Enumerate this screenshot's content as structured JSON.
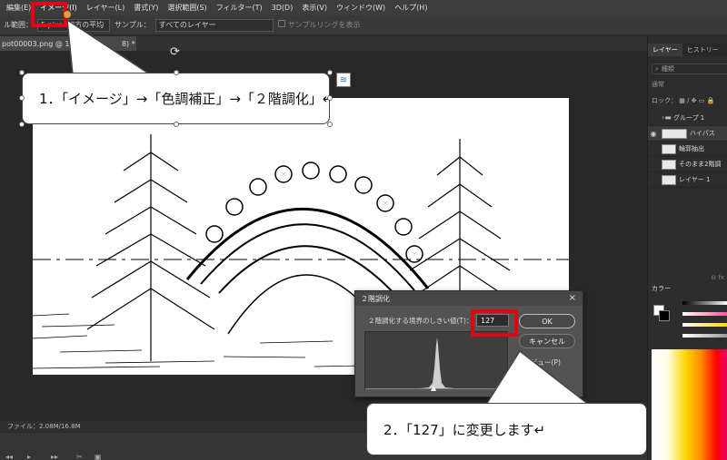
{
  "menu": [
    "編集(E)",
    "イメージ(I)",
    "レイヤー(L)",
    "書式(Y)",
    "選択範囲(S)",
    "フィルター(T)",
    "3D(D)",
    "表示(V)",
    "ウィンドウ(W)",
    "ヘルプ(H)"
  ],
  "options_bar": {
    "range_label": "ル範囲：",
    "range_value": "5 pixel 四方の平均",
    "sample_label": "サンプル：",
    "sample_value": "すべてのレイヤー",
    "ring_label": "サンプルリングを表示"
  },
  "document_tab": {
    "title": "pot00003.png @ 100% (",
    "suffix": "8) *",
    "close": "×"
  },
  "status": {
    "file_info": "ファイル：2.08M/16.8M"
  },
  "layers_panel": {
    "tabs": [
      "レイヤー",
      "ヒストリー"
    ],
    "search": "種類",
    "blend_mode": "通常",
    "lock_label": "ロック：",
    "layers": [
      {
        "name": "グループ 1",
        "type": "folder",
        "visible": false
      },
      {
        "name": "ハイパス",
        "type": "layer",
        "visible": true,
        "selected": true
      },
      {
        "name": "輪郭抽出",
        "type": "layer",
        "visible": false
      },
      {
        "name": "そのまま2階調",
        "type": "layer",
        "visible": false
      },
      {
        "name": "レイヤー 1",
        "type": "layer",
        "visible": false
      }
    ],
    "footer": "⊖  fx"
  },
  "color_panel": {
    "tab": "カラー"
  },
  "dialog": {
    "title": "２階調化",
    "threshold_label": "２階調化する境界のしきい値(T)：",
    "threshold_value": "127",
    "ok_label": "OK",
    "cancel_label": "キャンセル",
    "preview_label": "プレビュー(P)",
    "close": "×"
  },
  "callouts": {
    "step1": "1．「イメージ」→「色調補正」→「２階調化」↵",
    "step2": "2．「127」に変更します↵"
  },
  "colors": {
    "annotation_red": "#e60012",
    "ui_dark": "#282828"
  }
}
